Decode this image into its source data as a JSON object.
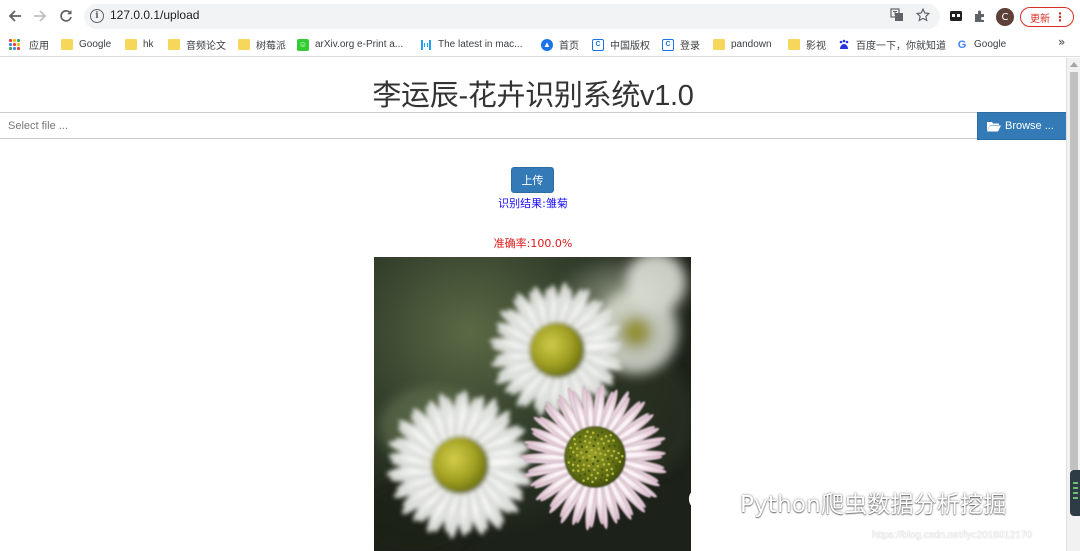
{
  "browser": {
    "url": "127.0.0.1/upload",
    "update_label": "更新",
    "profile_initial": "C",
    "bookmarks": [
      {
        "label": "应用",
        "icon": "apps-grid-icon"
      },
      {
        "label": "Google",
        "icon": "folder-icon"
      },
      {
        "label": "hk",
        "icon": "folder-icon"
      },
      {
        "label": "音频论文",
        "icon": "folder-icon"
      },
      {
        "label": "树莓派",
        "icon": "folder-icon"
      },
      {
        "label": "arXiv.org e-Print a...",
        "icon": "arxiv-icon"
      },
      {
        "label": "The latest in mac...",
        "icon": "paperswithcode-icon"
      },
      {
        "label": "首页",
        "icon": "site-icon"
      },
      {
        "label": "中国版权",
        "icon": "site-c-icon"
      },
      {
        "label": "登录",
        "icon": "site-c-icon"
      },
      {
        "label": "pandown",
        "icon": "folder-icon"
      },
      {
        "label": "影视",
        "icon": "folder-icon"
      },
      {
        "label": "百度一下，你就知道",
        "icon": "baidu-icon"
      },
      {
        "label": "Google",
        "icon": "google-icon"
      }
    ],
    "more_label": "»"
  },
  "page": {
    "title": "李运辰-花卉识别系统v1.0",
    "file_placeholder": "Select file ...",
    "browse_label": "Browse ...",
    "upload_label": "上传",
    "result_text": "识别结果:雏菊",
    "accuracy_text": "准确率:100.0%"
  },
  "watermark": {
    "text": "Python爬虫数据分析挖掘",
    "url": "https://blog.csdn.net/lyc2016012170"
  },
  "colors": {
    "primary_button": "#337ab7",
    "result_color": "#1a0dff",
    "accuracy_color": "#e01818"
  }
}
